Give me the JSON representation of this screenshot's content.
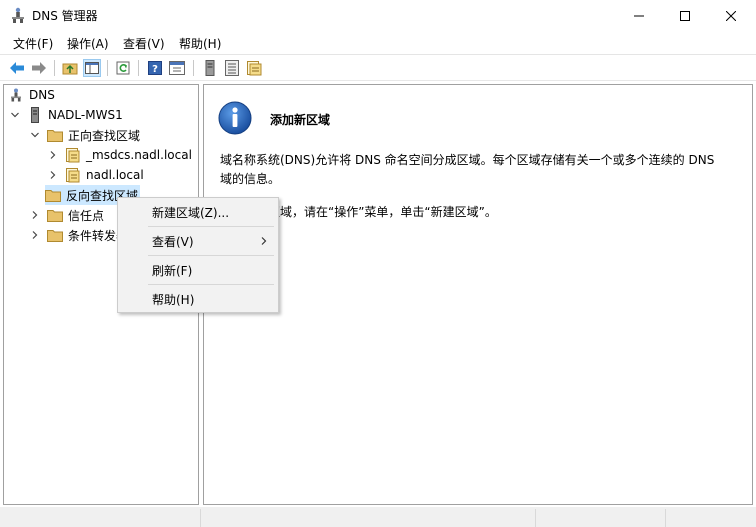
{
  "window": {
    "title": "DNS 管理器",
    "buttons": {
      "minimize": "minimize",
      "maximize": "maximize",
      "close": "close"
    }
  },
  "menubar": {
    "items": [
      {
        "label": "文件(F)"
      },
      {
        "label": "操作(A)"
      },
      {
        "label": "查看(V)"
      },
      {
        "label": "帮助(H)"
      }
    ]
  },
  "toolbar": {
    "buttons": [
      "back-icon",
      "forward-icon",
      "up-folder-icon",
      "show-hide-tree-icon",
      "refresh-icon",
      "help-icon",
      "properties-icon",
      "server-icon",
      "list-icon",
      "zone-icon"
    ]
  },
  "tree": {
    "items": [
      {
        "label": "DNS",
        "icon": "dns-icon"
      },
      {
        "label": "NADL-MWS1",
        "icon": "server-icon",
        "expanded": true
      },
      {
        "label": "正向查找区域",
        "icon": "folder-icon",
        "expanded": true
      },
      {
        "label": "_msdcs.nadl.local",
        "icon": "zone-icon"
      },
      {
        "label": "nadl.local",
        "icon": "zone-icon"
      },
      {
        "label": "反向查找区域",
        "icon": "folder-icon",
        "selected": true
      },
      {
        "label": "信任点",
        "icon": "folder-icon"
      },
      {
        "label": "条件转发器",
        "icon": "folder-icon"
      }
    ]
  },
  "content": {
    "heading": "添加新区域",
    "paragraph1": "域名称系统(DNS)允许将 DNS 命名空间分成区域。每个区域存储有关一个或多个连续的 DNS",
    "paragraph1b": "域的信息。",
    "paragraph2": "要添加新区域，请在“操作”菜单，单击“新建区域”。"
  },
  "context_menu": {
    "items": [
      {
        "label": "新建区域(Z)..."
      },
      {
        "label": "查看(V)",
        "submenu": true
      },
      {
        "label": "刷新(F)"
      },
      {
        "label": "帮助(H)"
      }
    ]
  },
  "colors": {
    "selection": "#cce8ff",
    "info_blue": "#1e5fb4",
    "folder": "#e8c26b"
  }
}
